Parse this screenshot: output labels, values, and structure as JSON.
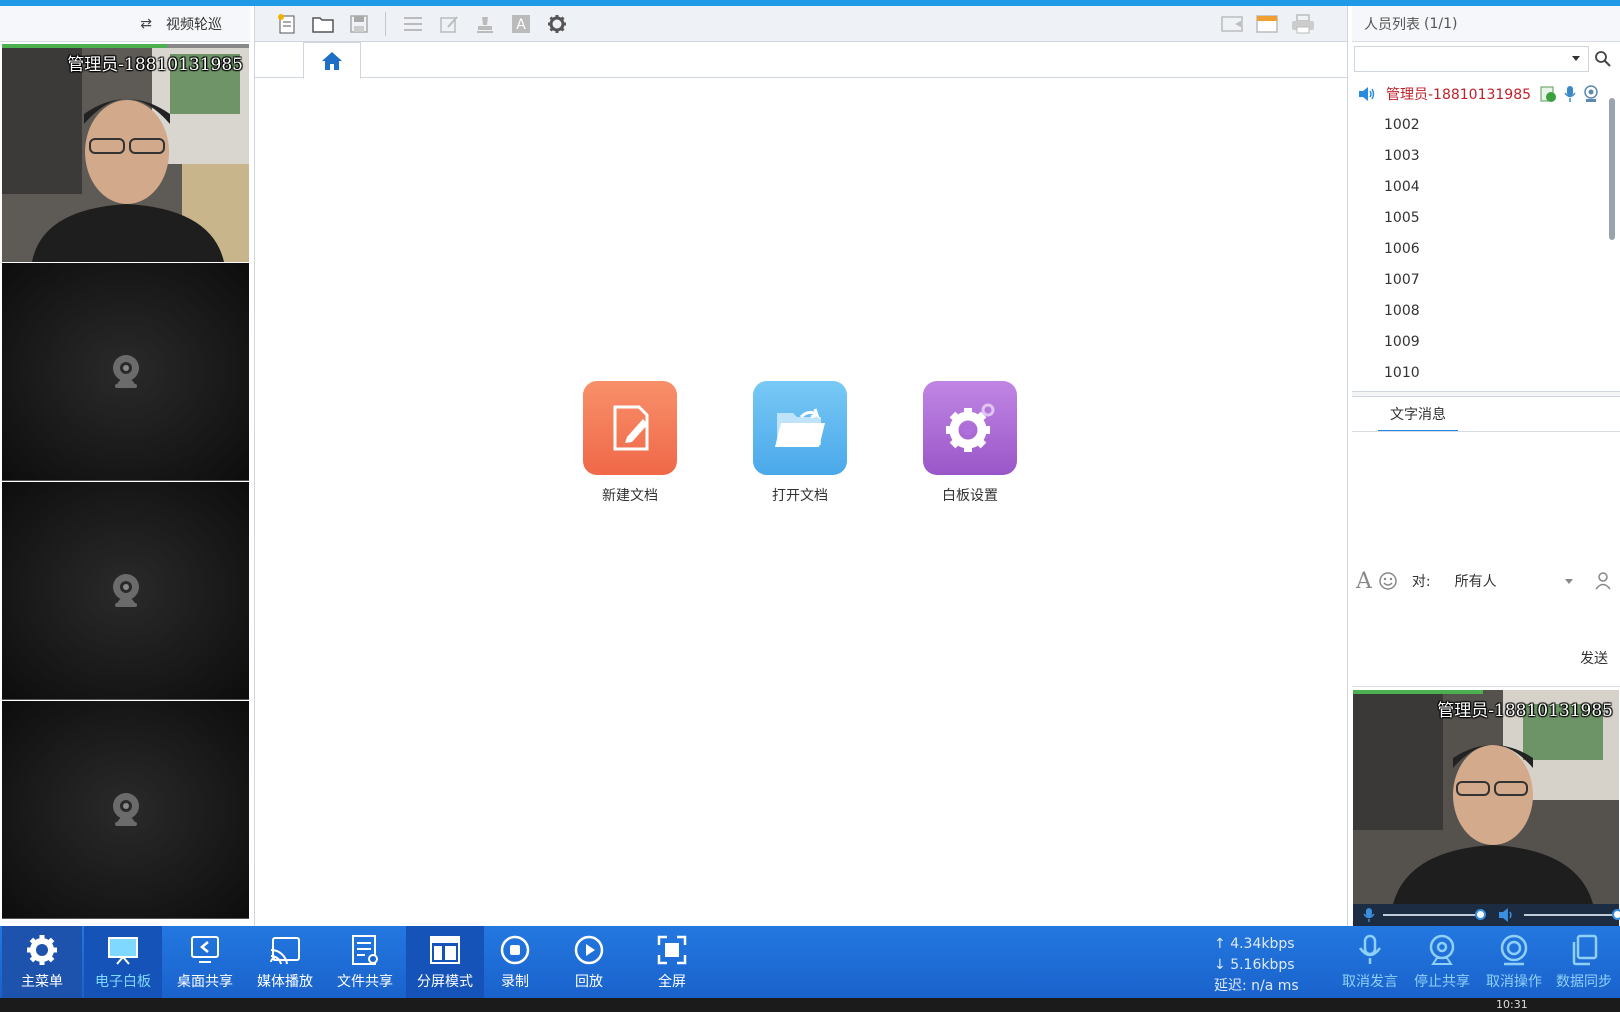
{
  "colors": {
    "accent": "#1e9ae6",
    "bottom_bar": "#1a62cc",
    "presenter": "#c0202a"
  },
  "left_panel": {
    "header_label": "视频轮巡",
    "rotate_icon": "swap-arrows-icon",
    "video_main_name": "管理员-18810131985",
    "empty_icon": "webcam-icon"
  },
  "toolbar": {
    "left_icons": [
      "new-page-icon",
      "open-folder-icon",
      "save-icon",
      "list-icon",
      "edit-icon",
      "stamp-icon",
      "text-a-icon",
      "gear-icon"
    ],
    "right_icons": [
      "slideshow-icon",
      "window-icon",
      "print-icon"
    ]
  },
  "tabs": {
    "home_icon": "home-icon"
  },
  "actions": [
    {
      "label": "新建文档",
      "icon": "new-document-icon",
      "color": "#f47a58"
    },
    {
      "label": "打开文档",
      "icon": "open-folder-icon",
      "color": "#5bb8ef"
    },
    {
      "label": "白板设置",
      "icon": "settings-gear-icon",
      "color": "#a86ad6"
    }
  ],
  "people": {
    "title": "人员列表",
    "count": "(1/1)",
    "presenter": "管理员-18810131985",
    "members": [
      "1002",
      "1003",
      "1004",
      "1005",
      "1006",
      "1007",
      "1008",
      "1009",
      "1010"
    ]
  },
  "messages": {
    "tab_label": "文字消息",
    "to_label": "对:",
    "recipient": "所有人",
    "send_label": "发送"
  },
  "right_video": {
    "name": "管理员-18810131985"
  },
  "bottom_bar": {
    "buttons": [
      {
        "label": "主菜单",
        "icon": "gear-icon"
      },
      {
        "label": "电子白板",
        "icon": "whiteboard-icon"
      },
      {
        "label": "桌面共享",
        "icon": "desktop-share-icon"
      },
      {
        "label": "媒体播放",
        "icon": "cast-icon"
      },
      {
        "label": "文件共享",
        "icon": "file-share-icon"
      },
      {
        "label": "分屏模式",
        "icon": "split-screen-icon"
      },
      {
        "label": "录制",
        "icon": "record-icon"
      },
      {
        "label": "回放",
        "icon": "play-icon"
      },
      {
        "label": "全屏",
        "icon": "fullscreen-icon"
      }
    ],
    "upload": "4.34kbps",
    "download": "5.16kbps",
    "latency_label": "延迟:",
    "latency_value": "n/a ms",
    "right_buttons": [
      {
        "label": "取消发言",
        "icon": "microphone-icon"
      },
      {
        "label": "停止共享",
        "icon": "webcam-share-icon"
      },
      {
        "label": "取消操作",
        "icon": "control-icon"
      },
      {
        "label": "数据同步",
        "icon": "sync-copy-icon"
      }
    ]
  },
  "taskbar": {
    "clock": "10:31"
  }
}
